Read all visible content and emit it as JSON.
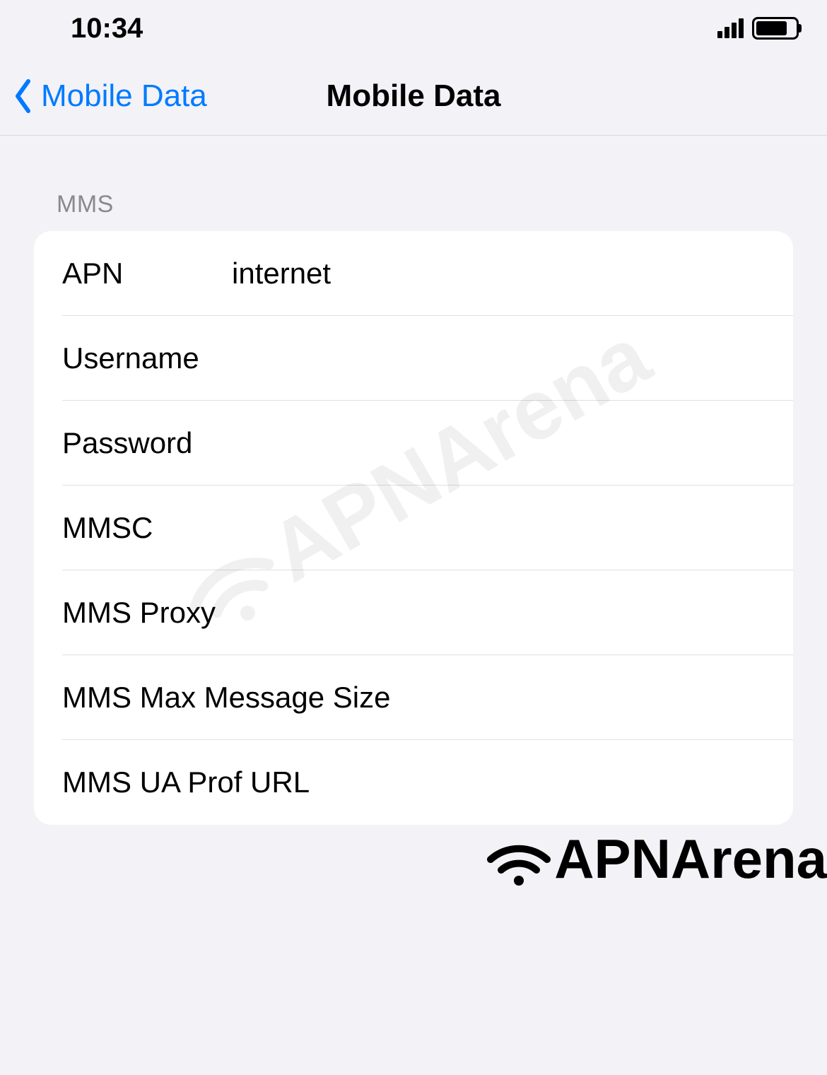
{
  "statusbar": {
    "time": "10:34"
  },
  "navbar": {
    "back_label": "Mobile Data",
    "title": "Mobile Data"
  },
  "section": {
    "header": "MMS",
    "rows": {
      "apn": {
        "label": "APN",
        "value": "internet"
      },
      "username": {
        "label": "Username",
        "value": ""
      },
      "password": {
        "label": "Password",
        "value": ""
      },
      "mmsc": {
        "label": "MMSC",
        "value": ""
      },
      "mms_proxy": {
        "label": "MMS Proxy",
        "value": ""
      },
      "mms_max": {
        "label": "MMS Max Message Size",
        "value": ""
      },
      "mms_ua": {
        "label": "MMS UA Prof URL",
        "value": ""
      }
    }
  },
  "watermark": {
    "text": "APNArena"
  }
}
